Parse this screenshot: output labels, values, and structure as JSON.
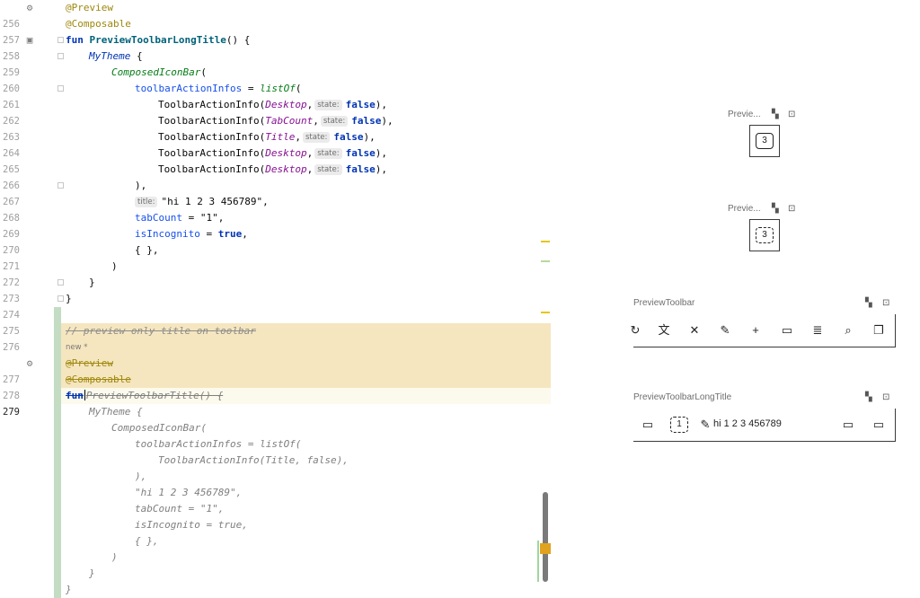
{
  "editor": {
    "lines": [
      {
        "n": "256",
        "t": "@Preview"
      },
      {
        "n": "257",
        "t": "@Composable"
      },
      {
        "n": "258",
        "a": "fun ",
        "b": "PreviewToolbarLongTitle",
        "c": "() {"
      },
      {
        "n": "259",
        "a": "MyTheme",
        "c": " {"
      },
      {
        "n": "260",
        "a": "ComposedIconBar",
        "c": "("
      },
      {
        "n": "261",
        "a": "toolbarActionInfos",
        "b": " = ",
        "c": "listOf",
        "d": "("
      },
      {
        "n": "262",
        "a": "ToolbarActionInfo(",
        "b": "Desktop",
        "c": ",",
        "h": "state:",
        "d": "false",
        "e": "),"
      },
      {
        "n": "263",
        "a": "ToolbarActionInfo(",
        "b": "TabCount",
        "c": ",",
        "h": "state:",
        "d": "false",
        "e": "),"
      },
      {
        "n": "264",
        "a": "ToolbarActionInfo(",
        "b": "Title",
        "c": ",",
        "h": "state:",
        "d": "false",
        "e": "),"
      },
      {
        "n": "265",
        "a": "ToolbarActionInfo(",
        "b": "Desktop",
        "c": ",",
        "h": "state:",
        "d": "false",
        "e": "),"
      },
      {
        "n": "266",
        "a": "ToolbarActionInfo(",
        "b": "Desktop",
        "c": ",",
        "h": "state:",
        "d": "false",
        "e": "),"
      },
      {
        "n": "267",
        "t": "),"
      },
      {
        "n": "268",
        "h": "title:",
        "t": "\"hi 1 2 3 456789\","
      },
      {
        "n": "269",
        "a": "tabCount",
        "b": " = ",
        "c": "\"1\","
      },
      {
        "n": "270",
        "a": "isIncognito",
        "b": " = ",
        "c": "true",
        "d": ","
      },
      {
        "n": "271",
        "t": "{ },"
      },
      {
        "n": "272",
        "t": ")"
      },
      {
        "n": "273",
        "t": "}"
      },
      {
        "n": "274",
        "t": "}"
      },
      {
        "n": "275",
        "t": ""
      },
      {
        "n": "276",
        "t": "// preview only title on toolbar"
      },
      {
        "n": "",
        "t": "new *"
      },
      {
        "n": "277",
        "t": "@Preview"
      },
      {
        "n": "278",
        "t": "@Composable"
      },
      {
        "n": "279",
        "a": "fun",
        "b": "PreviewToolbarTitle() {"
      },
      {
        "n": "",
        "t": "MyTheme {"
      },
      {
        "n": "",
        "t": "ComposedIconBar("
      },
      {
        "n": "",
        "t": "toolbarActionInfos = listOf("
      },
      {
        "n": "",
        "t": "ToolbarActionInfo(Title, false),"
      },
      {
        "n": "",
        "t": "),"
      },
      {
        "n": "",
        "t": "\"hi 1 2 3 456789\","
      },
      {
        "n": "",
        "t": "tabCount = \"1\","
      },
      {
        "n": "",
        "t": "isIncognito = true,"
      },
      {
        "n": "",
        "t": "{ },"
      },
      {
        "n": "",
        "t": ")"
      },
      {
        "n": "",
        "t": "}"
      },
      {
        "n": "",
        "t": "}"
      }
    ]
  },
  "previews": {
    "p1": {
      "title": "Previe...",
      "count": "3"
    },
    "p2": {
      "title": "Previe...",
      "count": "3"
    },
    "p3": {
      "title": "PreviewToolbar"
    },
    "p4": {
      "title": "PreviewToolbarLongTitle",
      "count": "1",
      "label": "hi 1 2 3 456789"
    }
  },
  "icons": {
    "settings": "gear-icon",
    "run": "run-preview-icon",
    "deploy": "deploy-preview-icon",
    "device": "device-preview-icon"
  },
  "colors": {
    "highlight": "#f5e6bf",
    "diff": "#c4dcc4",
    "keyword": "#0033b3"
  }
}
